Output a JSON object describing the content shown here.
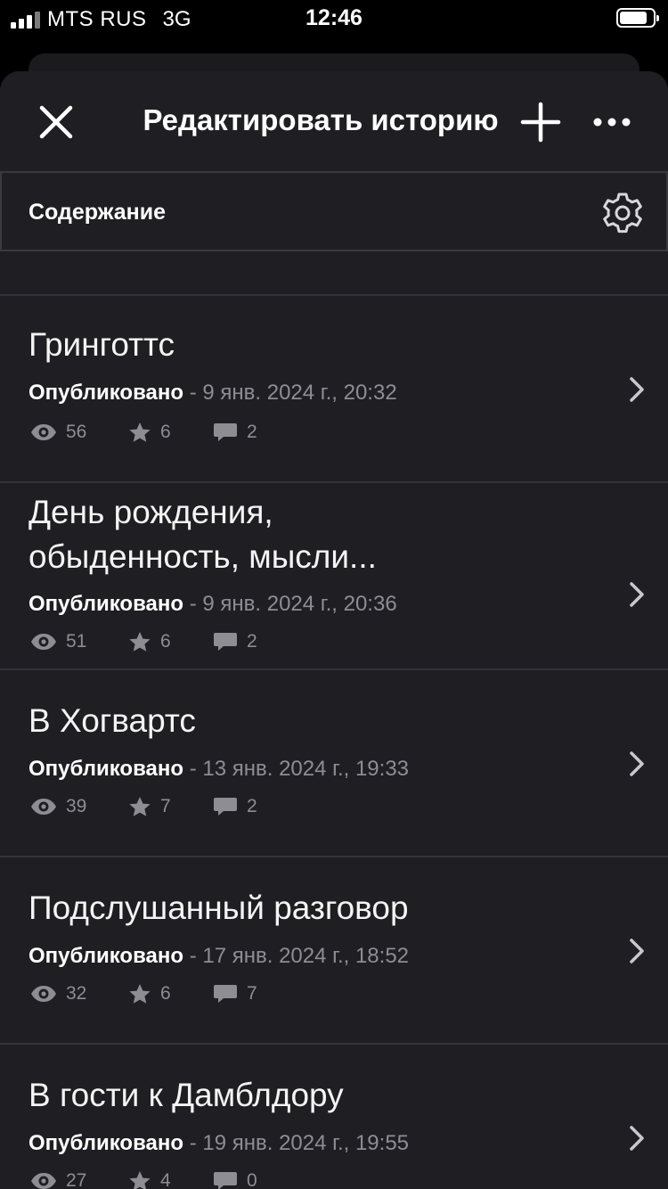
{
  "status_bar": {
    "carrier": "MTS RUS",
    "network": "3G",
    "time": "12:46"
  },
  "navbar": {
    "title": "Редактировать историю",
    "close_icon": "close-icon",
    "add_icon": "plus-icon",
    "more_icon": "more-icon"
  },
  "contents": {
    "label": "Содержание",
    "settings_icon": "gear-icon"
  },
  "parts": [
    {
      "title_lines": [
        "Гринготтс"
      ],
      "status": "Опубликовано",
      "date": " - 9 янв. 2024 г., 20:32",
      "views": "56",
      "votes": "6",
      "comments": "2"
    },
    {
      "title_lines": [
        "День рождения,",
        "обыденность, мысли..."
      ],
      "status": "Опубликовано",
      "date": " - 9 янв. 2024 г., 20:36",
      "views": "51",
      "votes": "6",
      "comments": "2"
    },
    {
      "title_lines": [
        "В Хогвартс"
      ],
      "status": "Опубликовано",
      "date": " - 13 янв. 2024 г., 19:33",
      "views": "39",
      "votes": "7",
      "comments": "2"
    },
    {
      "title_lines": [
        "Подслушанный разговор"
      ],
      "status": "Опубликовано",
      "date": " - 17 янв. 2024 г., 18:52",
      "views": "32",
      "votes": "6",
      "comments": "7"
    },
    {
      "title_lines": [
        "В гости к Дамблдору"
      ],
      "status": "Опубликовано",
      "date": " - 19 янв. 2024 г., 19:55",
      "views": "27",
      "votes": "4",
      "comments": "0"
    }
  ],
  "colors": {
    "background": "#1f1e22",
    "muted_text": "#8e8d94",
    "divider": "#34333a"
  }
}
